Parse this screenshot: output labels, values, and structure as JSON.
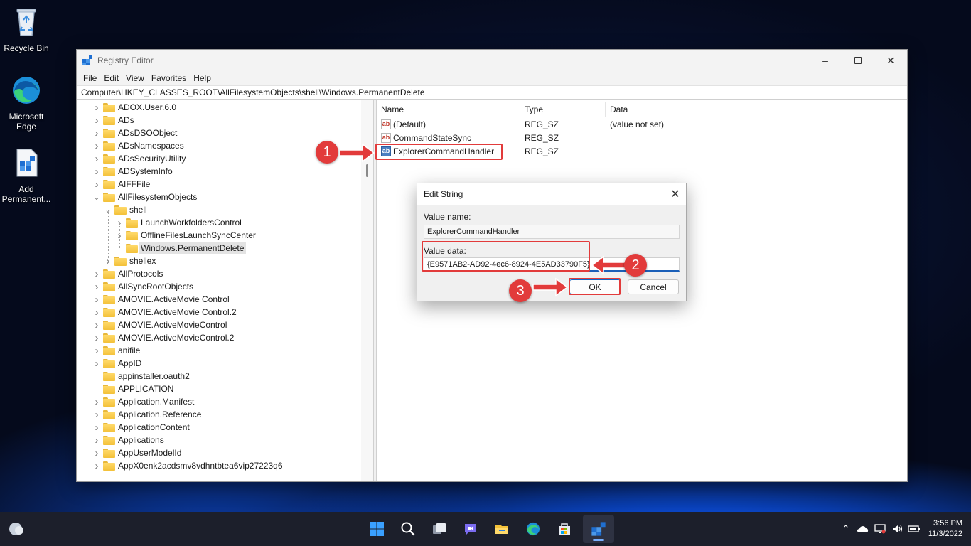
{
  "desktop": {
    "icons": [
      {
        "label": "Recycle Bin"
      },
      {
        "label": "Microsoft Edge"
      },
      {
        "label": "Add Permanent..."
      }
    ]
  },
  "window": {
    "title": "Registry Editor",
    "menu": [
      "File",
      "Edit",
      "View",
      "Favorites",
      "Help"
    ],
    "address": "Computer\\HKEY_CLASSES_ROOT\\AllFilesystemObjects\\shell\\Windows.PermanentDelete",
    "tree": [
      {
        "label": "ADOX.User.6.0",
        "level": 0,
        "expander": "closed"
      },
      {
        "label": "ADs",
        "level": 0,
        "expander": "closed"
      },
      {
        "label": "ADsDSOObject",
        "level": 0,
        "expander": "closed"
      },
      {
        "label": "ADsNamespaces",
        "level": 0,
        "expander": "closed"
      },
      {
        "label": "ADsSecurityUtility",
        "level": 0,
        "expander": "closed"
      },
      {
        "label": "ADSystemInfo",
        "level": 0,
        "expander": "closed"
      },
      {
        "label": "AIFFFile",
        "level": 0,
        "expander": "closed"
      },
      {
        "label": "AllFilesystemObjects",
        "level": 0,
        "expander": "open"
      },
      {
        "label": "shell",
        "level": 1,
        "expander": "open"
      },
      {
        "label": "LaunchWorkfoldersControl",
        "level": 2,
        "expander": "closed"
      },
      {
        "label": "OfflineFilesLaunchSyncCenter",
        "level": 2,
        "expander": "closed"
      },
      {
        "label": "Windows.PermanentDelete",
        "level": 2,
        "expander": "none",
        "selected": true
      },
      {
        "label": "shellex",
        "level": 1,
        "expander": "closed"
      },
      {
        "label": "AllProtocols",
        "level": 0,
        "expander": "closed"
      },
      {
        "label": "AllSyncRootObjects",
        "level": 0,
        "expander": "closed"
      },
      {
        "label": "AMOVIE.ActiveMovie Control",
        "level": 0,
        "expander": "closed"
      },
      {
        "label": "AMOVIE.ActiveMovie Control.2",
        "level": 0,
        "expander": "closed"
      },
      {
        "label": "AMOVIE.ActiveMovieControl",
        "level": 0,
        "expander": "closed"
      },
      {
        "label": "AMOVIE.ActiveMovieControl.2",
        "level": 0,
        "expander": "closed"
      },
      {
        "label": "anifile",
        "level": 0,
        "expander": "closed"
      },
      {
        "label": "AppID",
        "level": 0,
        "expander": "closed"
      },
      {
        "label": "appinstaller.oauth2",
        "level": 0,
        "expander": "none"
      },
      {
        "label": "APPLICATION",
        "level": 0,
        "expander": "none"
      },
      {
        "label": "Application.Manifest",
        "level": 0,
        "expander": "closed"
      },
      {
        "label": "Application.Reference",
        "level": 0,
        "expander": "closed"
      },
      {
        "label": "ApplicationContent",
        "level": 0,
        "expander": "closed"
      },
      {
        "label": "Applications",
        "level": 0,
        "expander": "closed"
      },
      {
        "label": "AppUserModelId",
        "level": 0,
        "expander": "closed"
      },
      {
        "label": "AppX0enk2acdsmv8vdhntbtea6vip27223q6",
        "level": 0,
        "expander": "closed"
      }
    ],
    "columns": {
      "name": "Name",
      "type": "Type",
      "data": "Data"
    },
    "values": [
      {
        "name": "(Default)",
        "type": "REG_SZ",
        "data": "(value not set)"
      },
      {
        "name": "CommandStateSync",
        "type": "REG_SZ",
        "data": ""
      },
      {
        "name": "ExplorerCommandHandler",
        "type": "REG_SZ",
        "data": ""
      }
    ]
  },
  "dialog": {
    "title": "Edit String",
    "value_name_label": "Value name:",
    "value_name": "ExplorerCommandHandler",
    "value_data_label": "Value data:",
    "value_data": "{E9571AB2-AD92-4ec6-8924-4E5AD33790F5}",
    "ok_label": "OK",
    "cancel_label": "Cancel"
  },
  "callouts": [
    "1",
    "2",
    "3"
  ],
  "taskbar": {
    "time": "3:56 PM",
    "date": "11/3/2022"
  },
  "colors": {
    "accent": "#0f66c9",
    "callout": "#e23b3b",
    "folder": "#f3c139"
  }
}
